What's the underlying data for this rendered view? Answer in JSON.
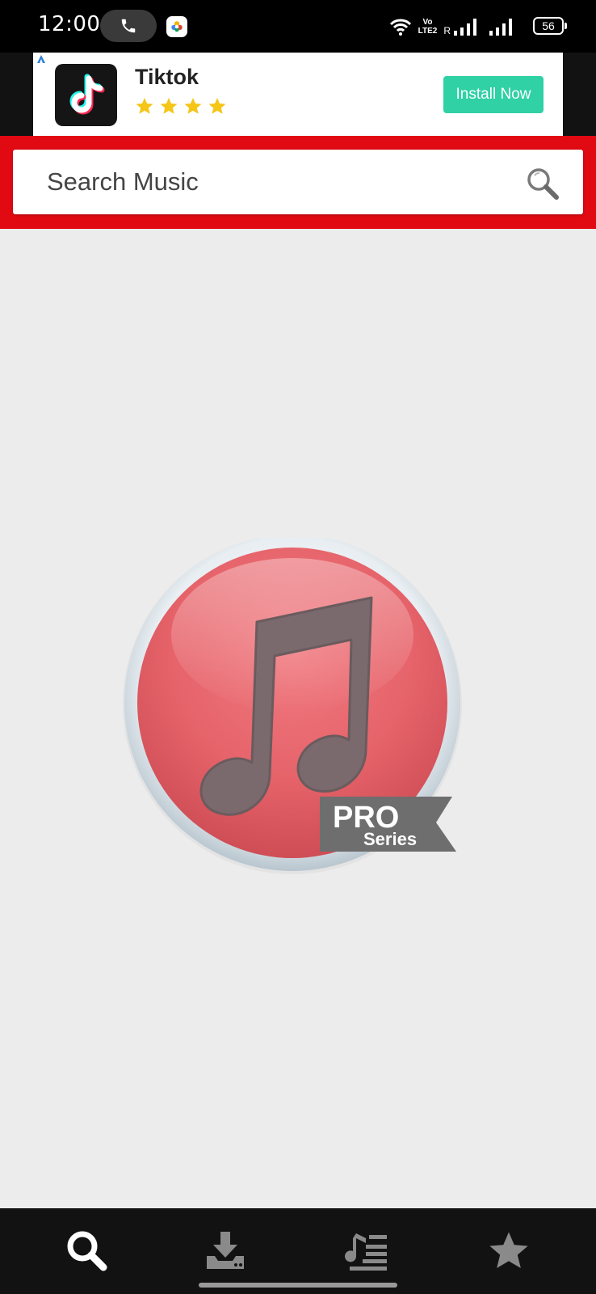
{
  "status_bar": {
    "time": "12:00",
    "volte_line1": "Vo",
    "volte_line2": "LTE2",
    "roaming": "R",
    "battery": "56",
    "icons": [
      "call-icon",
      "photos-app-icon",
      "wifi-icon",
      "signal-icon",
      "battery-icon"
    ]
  },
  "ad": {
    "app_name": "Tiktok",
    "rating_stars": 4,
    "install_label": "Install Now",
    "colors": {
      "button": "#2fd1a5",
      "star": "#f5c518"
    }
  },
  "search": {
    "placeholder": "Search Music",
    "value": ""
  },
  "logo": {
    "badge_line1": "PRO",
    "badge_line2": "Series"
  },
  "bottom_nav": {
    "items": [
      "search-icon",
      "download-icon",
      "playlist-icon",
      "star-icon"
    ],
    "active": "search-icon"
  },
  "colors": {
    "header_red": "#e10a13",
    "background": "#ececec",
    "nav_background": "#121212"
  }
}
